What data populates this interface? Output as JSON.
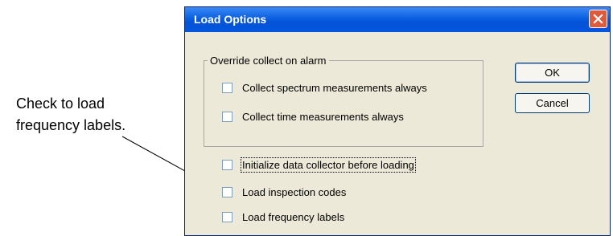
{
  "annotation": {
    "callout_line1": "Check to load",
    "callout_line2": "frequency labels."
  },
  "dialog": {
    "title": "Load Options",
    "close_icon": "close-x-icon",
    "group_label": "Override collect on alarm",
    "group_options": [
      {
        "label": "Collect spectrum measurements always",
        "checked": false
      },
      {
        "label": "Collect time measurements always",
        "checked": false
      }
    ],
    "options": [
      {
        "label": "Initialize data collector before loading",
        "checked": false,
        "focused": true
      },
      {
        "label": "Load inspection codes",
        "checked": false
      },
      {
        "label": "Load frequency labels",
        "checked": false
      }
    ],
    "ok_label": "OK",
    "cancel_label": "Cancel"
  },
  "colors": {
    "title_bar": "#0a5fe0",
    "close_button": "#e0593a",
    "dialog_bg": "#ece9d8"
  }
}
